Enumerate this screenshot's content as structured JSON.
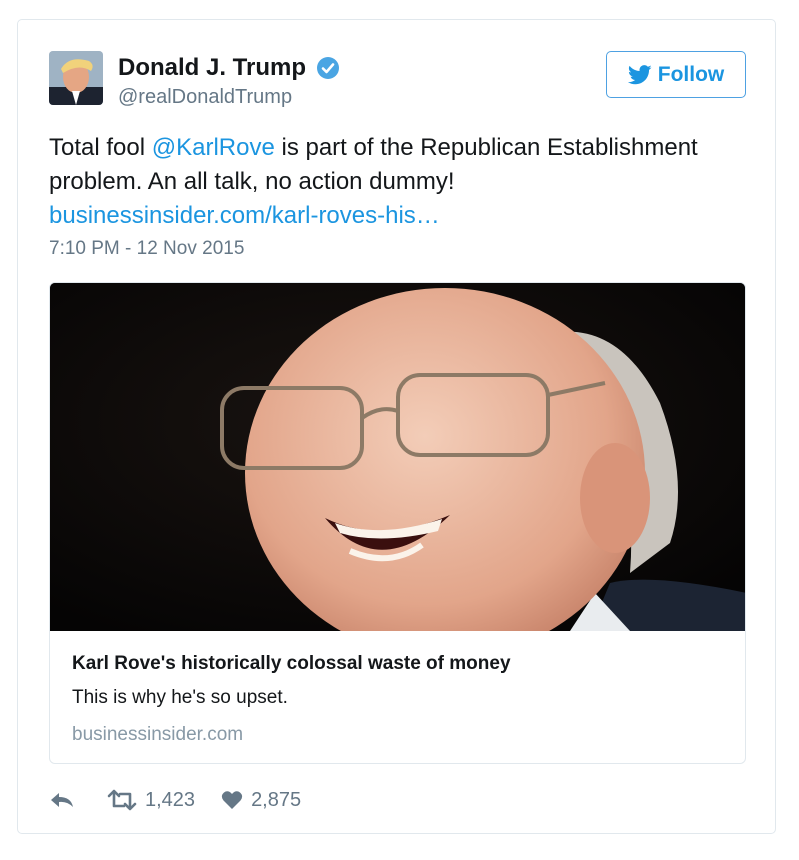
{
  "user": {
    "name": "Donald J. Trump",
    "handle": "@realDonaldTrump"
  },
  "follow_label": "Follow",
  "tweet": {
    "text_before": "Total fool ",
    "mention": "@KarlRove",
    "text_after": " is part of the Republican Establishment problem. An all talk, no action dummy!",
    "link": "businessinsider.com/karl-roves-his…",
    "timestamp": "7:10 PM - 12 Nov 2015"
  },
  "card": {
    "title": "Karl Rove's historically colossal waste of money",
    "description": "This is why he's so upset.",
    "domain": "businessinsider.com"
  },
  "actions": {
    "retweets": "1,423",
    "likes": "2,875"
  },
  "colors": {
    "link": "#1b95e0",
    "muted": "#657786",
    "border": "#e1e8ed",
    "verified": "#1da1f2"
  },
  "icons": [
    "reply-icon",
    "retweet-icon",
    "heart-icon",
    "twitter-bird-icon",
    "verified-badge-icon"
  ]
}
